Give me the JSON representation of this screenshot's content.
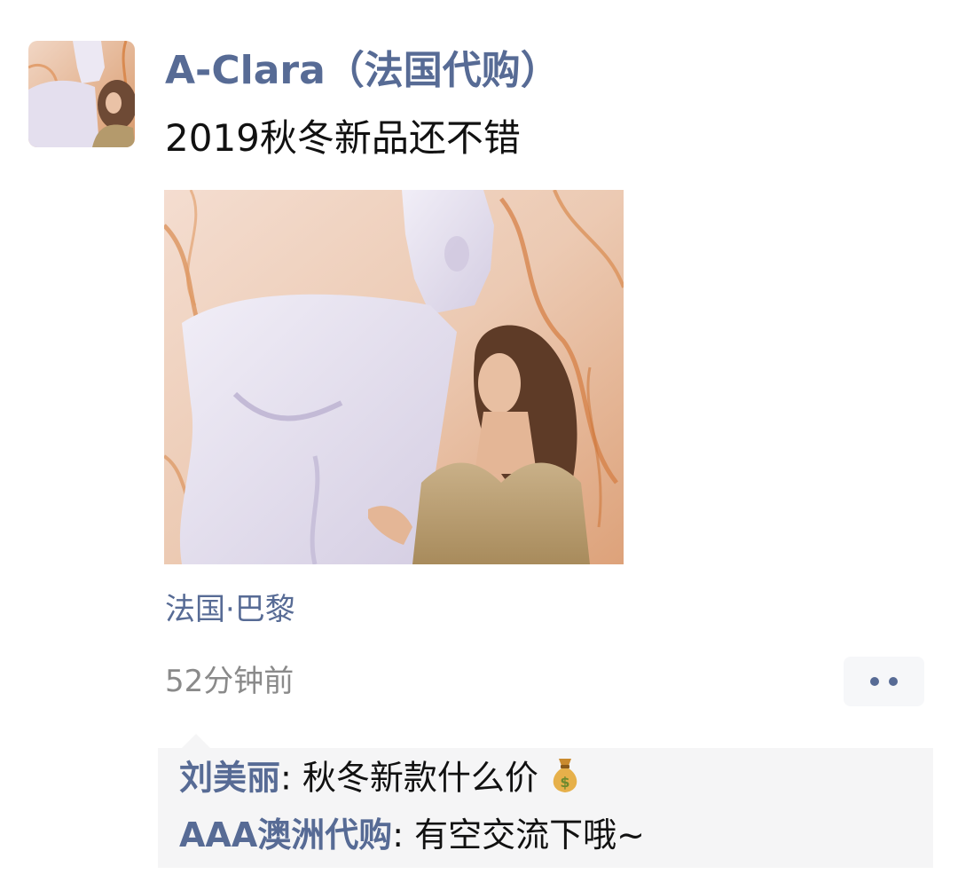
{
  "post": {
    "author": "A-Clara（法国代购）",
    "text": "2019秋冬新品还不错",
    "location": "法国·巴黎",
    "time": "52分钟前"
  },
  "photo_icon": "photo-of-woman-beside-white-statue",
  "avatar_icon": "profile-photo",
  "more_icon": "two-dots-icon",
  "comments": [
    {
      "user": "刘美丽",
      "separator": ": ",
      "text": "秋冬新款什么价",
      "emoji": "money-bag-icon"
    },
    {
      "user": "AAA澳洲代购",
      "separator": ": ",
      "text": "有空交流下哦~"
    }
  ],
  "colors": {
    "link": "#576b95",
    "text": "#111111",
    "muted": "#8a8a8a",
    "comment_bg": "#f5f5f6"
  }
}
